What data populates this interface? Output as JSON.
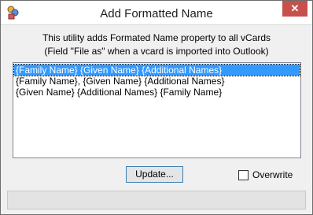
{
  "window": {
    "title": "Add Formatted Name",
    "close_label": "✕"
  },
  "description": {
    "line1": "This utility adds Formated Name property to all vCards",
    "line2": "(Field \"File as\" when a vcard is imported into Outlook)"
  },
  "list": {
    "items": [
      {
        "label": "{Family Name} {Given Name} {Additional Names}",
        "selected": true
      },
      {
        "label": "{Family Name}, {Given Name} {Additional Names}",
        "selected": false
      },
      {
        "label": "{Given Name} {Additional Names} {Family Name}",
        "selected": false
      }
    ]
  },
  "buttons": {
    "update_label": "Update..."
  },
  "options": {
    "overwrite_label": "Overwrite",
    "overwrite_checked": false
  },
  "icons": {
    "app": "vcard-app-icon",
    "close": "close-icon"
  },
  "colors": {
    "selection": "#3399ff",
    "close_button": "#c7504c"
  }
}
